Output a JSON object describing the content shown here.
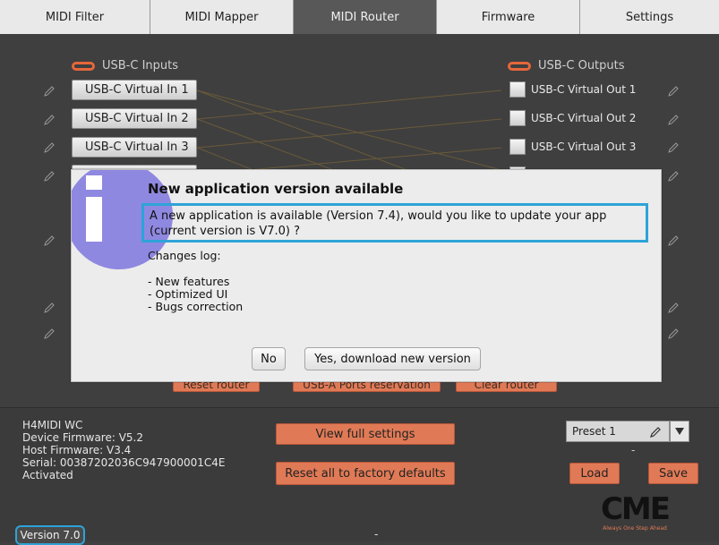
{
  "tabs": [
    {
      "label": "MIDI Filter"
    },
    {
      "label": "MIDI Mapper"
    },
    {
      "label": "MIDI Router"
    },
    {
      "label": "Firmware"
    },
    {
      "label": "Settings"
    }
  ],
  "router": {
    "inputs_label": "USB-C Inputs",
    "outputs_label": "USB-C Outputs",
    "inputs": [
      "USB-C Virtual In 1",
      "USB-C Virtual In 2",
      "USB-C Virtual In 3"
    ],
    "outputs": [
      "USB-C Virtual Out 1",
      "USB-C Virtual Out 2",
      "USB-C Virtual Out 3"
    ],
    "hidden_buttons": [
      "Reset router",
      "USB-A Ports reservation",
      "Clear router"
    ]
  },
  "dialog": {
    "title": "New application version available",
    "message": "A new application is available (Version 7.4), would you like to update your app (current version is V7.0) ?",
    "changes_title": "Changes log:",
    "changes": [
      "- New features",
      "- Optimized UI",
      "- Bugs correction"
    ],
    "no_label": "No",
    "yes_label": "Yes, download new version"
  },
  "device": {
    "name": "H4MIDI WC",
    "device_firmware": "Device Firmware: V5.2",
    "host_firmware": "Host Firmware: V3.4",
    "serial": "Serial: 00387202036C947900001C4E",
    "status": "Activated"
  },
  "actions": {
    "view_settings": "View full settings",
    "reset_factory": "Reset all to factory defaults",
    "load": "Load",
    "save": "Save"
  },
  "preset": {
    "value": "Preset 1",
    "dash": "-"
  },
  "footer": {
    "version": "Version 7.0",
    "dash": "-"
  },
  "logo": {
    "text": "CME",
    "tagline": "Always One Step Ahead"
  },
  "colors": {
    "accent_orange": "#e07a56",
    "highlight_blue": "#2ea3d8"
  }
}
